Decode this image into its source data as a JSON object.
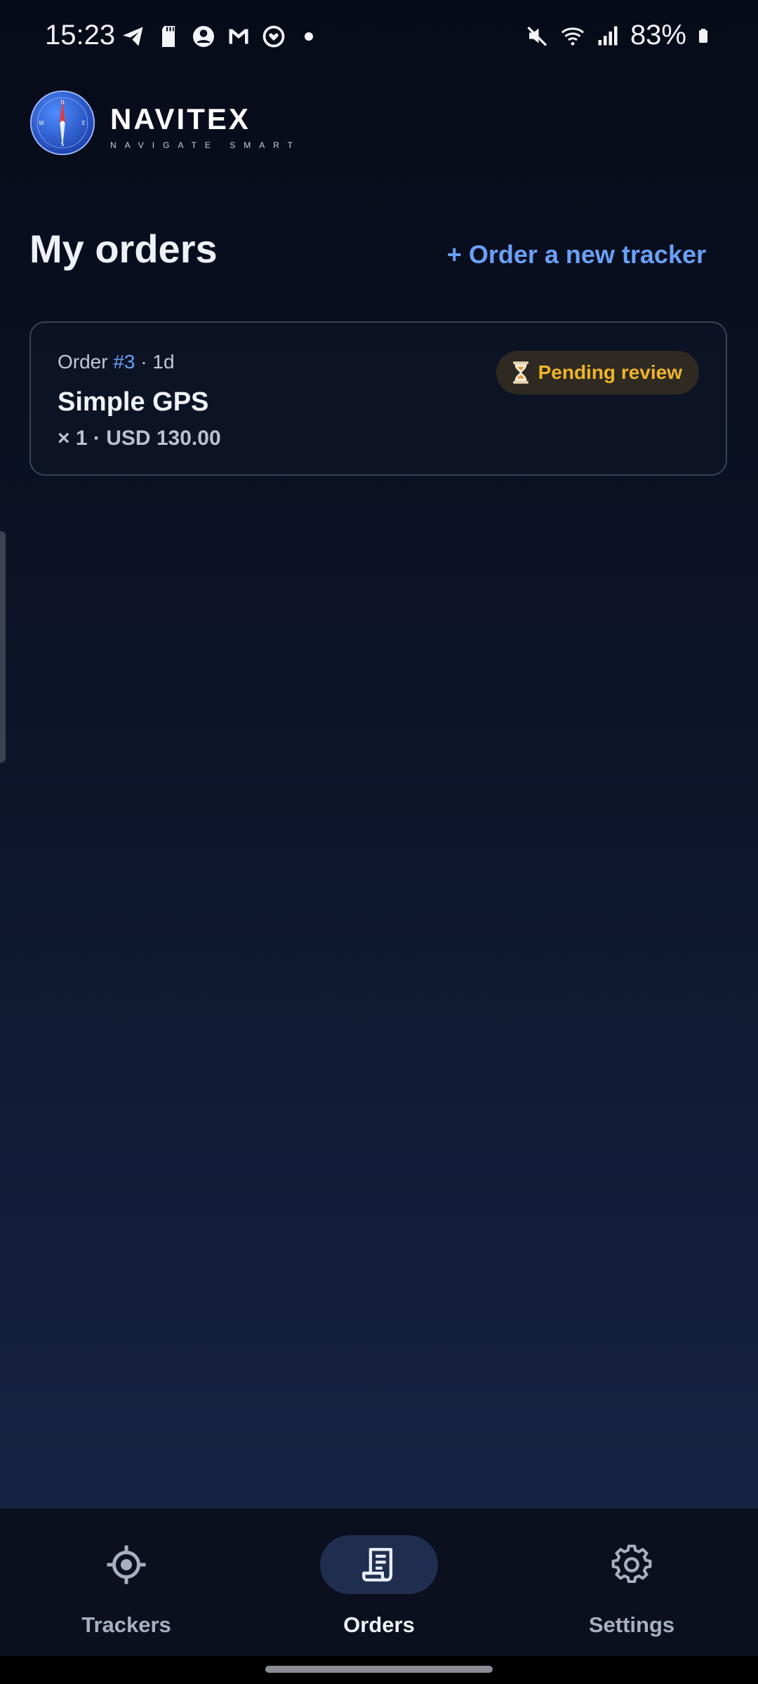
{
  "status_bar": {
    "time": "15:23",
    "battery": "83%",
    "left_icons": [
      "telegram-icon",
      "sd-card-icon",
      "account-circle-icon",
      "gmail-icon",
      "heart-sync-icon",
      "dot-icon"
    ],
    "right_icons": [
      "mute-icon",
      "wifi-icon",
      "signal-icon",
      "battery-icon"
    ]
  },
  "brand": {
    "name": "NAVITEX",
    "tagline": "NAVIGATE SMART",
    "logo_icon": "compass-icon"
  },
  "page": {
    "title": "My orders",
    "new_order_link": "+ Order a new tracker"
  },
  "orders": [
    {
      "label": "Order",
      "number": "#3",
      "age": "· 1d",
      "product": "Simple GPS",
      "quantity_price": "× 1 · USD 130.00",
      "status": "Pending review",
      "status_icon": "hourglass-icon",
      "status_color": "#f0b429"
    }
  ],
  "nav": {
    "items": [
      {
        "label": "Trackers",
        "icon": "target-icon",
        "active": false
      },
      {
        "label": "Orders",
        "icon": "receipt-icon",
        "active": true
      },
      {
        "label": "Settings",
        "icon": "gear-icon",
        "active": false
      }
    ]
  },
  "colors": {
    "accent": "#6aa0f5",
    "pending": "#f0b429",
    "nav_active_bg": "#1f2e4f"
  }
}
